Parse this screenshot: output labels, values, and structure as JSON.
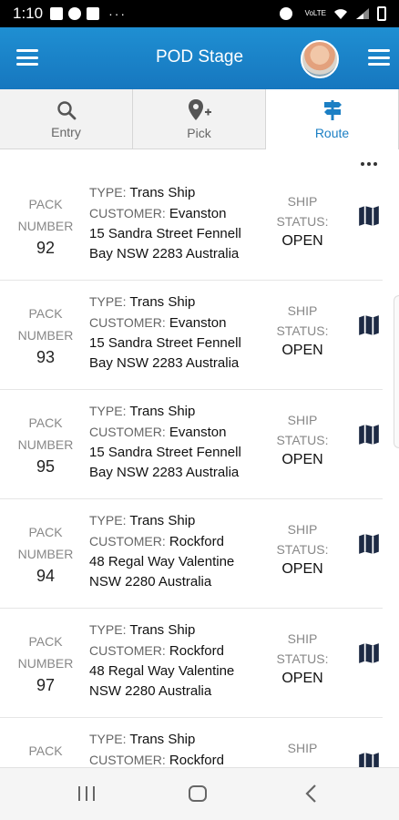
{
  "status_bar": {
    "time": "1:10",
    "notif_dots": "···",
    "network": "VoLTE"
  },
  "header": {
    "title": "POD Stage"
  },
  "tabs": [
    {
      "label": "Entry",
      "icon": "search-icon"
    },
    {
      "label": "Pick",
      "icon": "location-plus-icon"
    },
    {
      "label": "Route",
      "icon": "signpost-icon"
    }
  ],
  "labels": {
    "pack": "PACK",
    "number": "NUMBER",
    "type": "TYPE:",
    "customer": "CUSTOMER:",
    "ship": "SHIP",
    "status": "STATUS:"
  },
  "packs": [
    {
      "number": "92",
      "type": "Trans Ship",
      "customer": "Evanston",
      "addr1": "15 Sandra Street Fennell",
      "addr2": "Bay NSW 2283 Australia",
      "status": "OPEN"
    },
    {
      "number": "93",
      "type": "Trans Ship",
      "customer": "Evanston",
      "addr1": "15 Sandra Street Fennell",
      "addr2": "Bay NSW 2283 Australia",
      "status": "OPEN"
    },
    {
      "number": "95",
      "type": "Trans Ship",
      "customer": "Evanston",
      "addr1": "15 Sandra Street Fennell",
      "addr2": "Bay NSW 2283 Australia",
      "status": "OPEN"
    },
    {
      "number": "94",
      "type": "Trans Ship",
      "customer": "Rockford",
      "addr1": "48 Regal Way Valentine",
      "addr2": "NSW 2280 Australia",
      "status": "OPEN"
    },
    {
      "number": "97",
      "type": "Trans Ship",
      "customer": "Rockford",
      "addr1": "48 Regal Way Valentine",
      "addr2": "NSW 2280 Australia",
      "status": "OPEN"
    },
    {
      "number": "",
      "type": "Trans Ship",
      "customer": "Rockford",
      "addr1": "",
      "addr2": "",
      "status": ""
    }
  ],
  "colors": {
    "header": "#1677bf",
    "accent": "#1b7fc4",
    "map_icon": "#1d2a44"
  }
}
